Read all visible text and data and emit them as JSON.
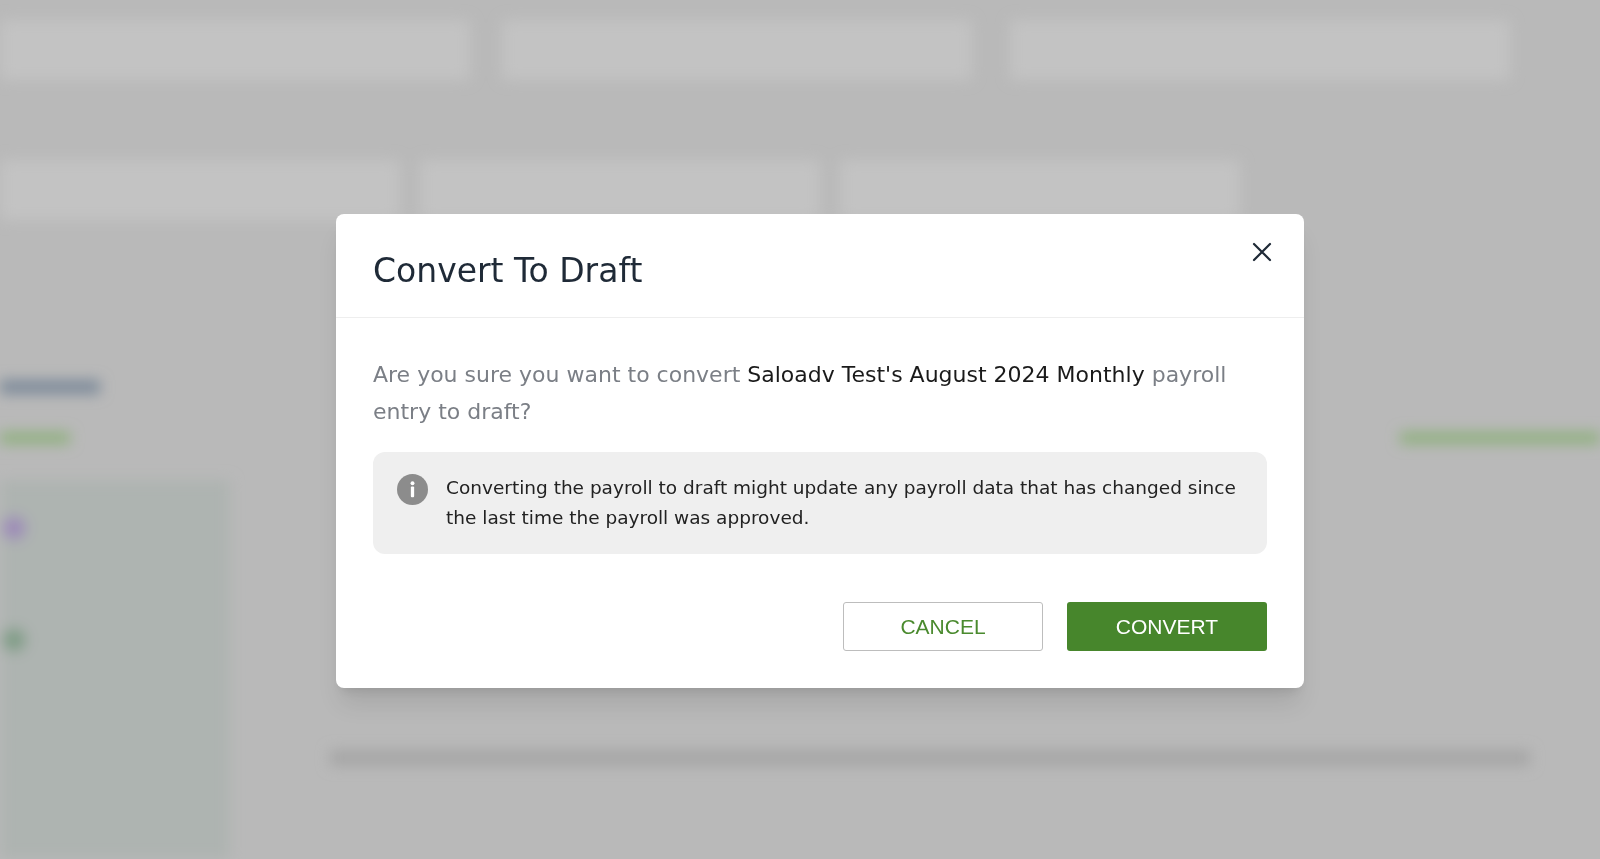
{
  "dialog": {
    "title": "Convert To Draft",
    "message": [
      {
        "text": "Are you sure you want to convert ",
        "emphasis": false
      },
      {
        "text": "Saloadv Test's August 2024 Monthly",
        "emphasis": true
      },
      {
        "text": " payroll entry to draft?",
        "emphasis": false
      }
    ],
    "info": "Converting the payroll to draft might update any payroll data that has changed since the last time the payroll was approved.",
    "buttons": [
      {
        "label": "CANCEL",
        "kind": "secondary"
      },
      {
        "label": "CONVERT",
        "kind": "primary"
      }
    ]
  }
}
